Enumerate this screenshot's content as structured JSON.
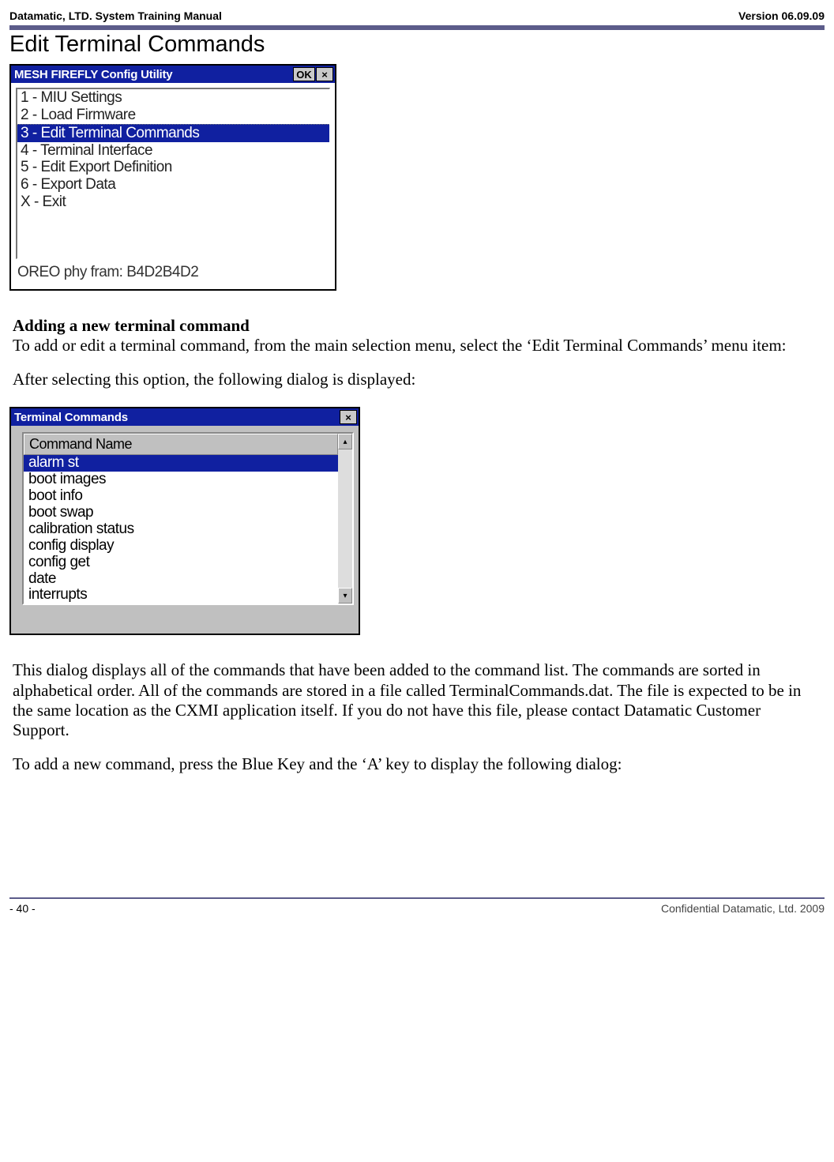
{
  "header": {
    "left": "Datamatic, LTD. System Training  Manual",
    "right": "Version 06.09.09"
  },
  "section_title": "Edit Terminal Commands",
  "win1": {
    "title": "MESH FIREFLY Config Utility",
    "ok": "OK",
    "close": "×",
    "items": [
      "1 - MIU Settings",
      "2 - Load Firmware",
      "3 - Edit Terminal Commands",
      "4 - Terminal Interface",
      "5 - Edit Export Definition",
      "6 - Export Data",
      "X - Exit"
    ],
    "selected_index": 2,
    "status": "OREO phy fram: B4D2B4D2"
  },
  "subheading1": "Adding a new terminal command",
  "para1": "To add or edit a terminal command, from the main selection menu, select the ‘Edit Terminal Commands’ menu item:",
  "para2": "After selecting this option, the following dialog is displayed:",
  "win2": {
    "title": "Terminal Commands",
    "close": "×",
    "column_header": "Command Name",
    "items": [
      "alarm st",
      "boot images",
      "boot info",
      "boot swap",
      "calibration status",
      "config display",
      "config get",
      "date",
      "interrupts"
    ],
    "selected_index": 0,
    "scroll_up": "▴",
    "scroll_down": "▾"
  },
  "para3": "This dialog displays all of the commands that have been added to the command list.  The commands are sorted in alphabetical order.  All of the commands are stored in a file called TerminalCommands.dat.  The file is expected to be in the same location as the CXMI application itself.  If you do not have this file, please contact Datamatic Customer Support.",
  "para4": "To add a new command, press the Blue Key and the ‘A’ key to display the following dialog:",
  "footer": {
    "left": "- 40 -",
    "right": "Confidential Datamatic, Ltd. 2009"
  }
}
